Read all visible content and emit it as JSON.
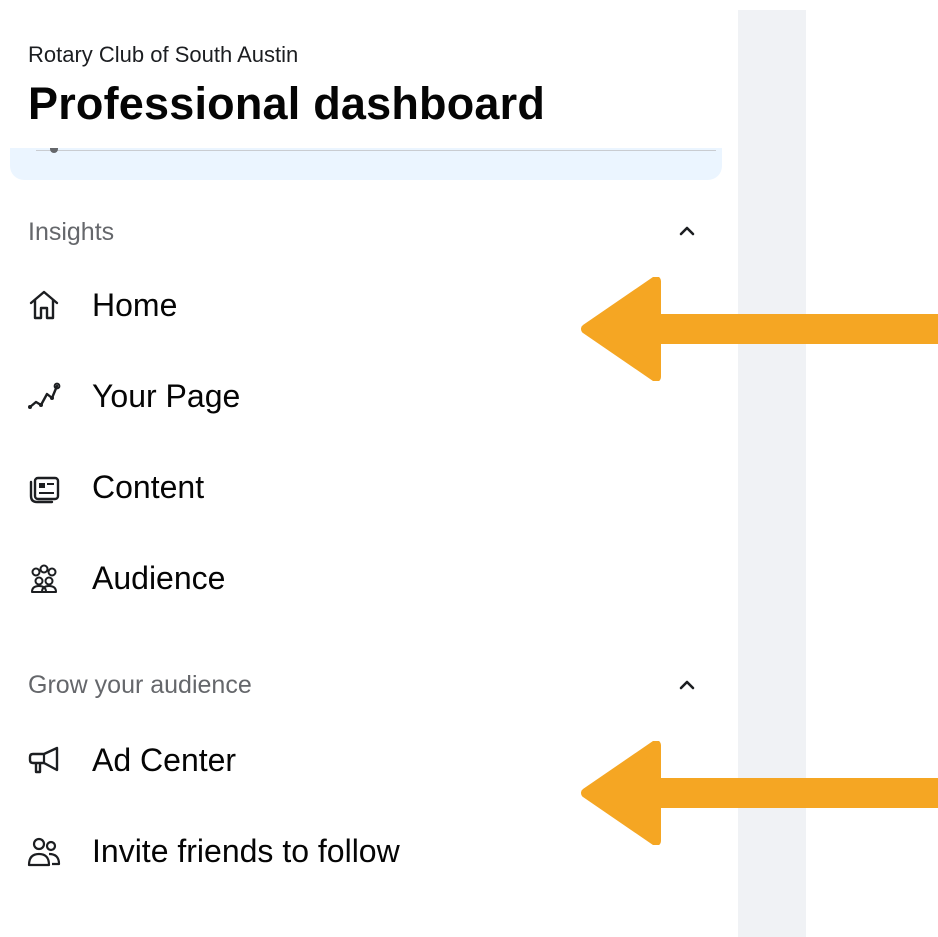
{
  "header": {
    "subtitle": "Rotary Club of South Austin",
    "title": "Professional dashboard"
  },
  "sections": {
    "insights": {
      "label": "Insights",
      "items": [
        {
          "label": "Home",
          "icon": "home-icon"
        },
        {
          "label": "Your Page",
          "icon": "trend-line-icon"
        },
        {
          "label": "Content",
          "icon": "content-icon"
        },
        {
          "label": "Audience",
          "icon": "audience-icon"
        }
      ]
    },
    "grow": {
      "label": "Grow your audience",
      "items": [
        {
          "label": "Ad Center",
          "icon": "megaphone-icon"
        },
        {
          "label": "Invite friends to follow",
          "icon": "invite-friends-icon"
        }
      ]
    }
  },
  "colors": {
    "arrow": "#f5a623",
    "sidebar_bg": "#ffffff",
    "strip_bg": "#f0f2f5",
    "blue_card": "#ebf5ff",
    "muted_text": "#65676b",
    "primary_text": "#050505"
  }
}
